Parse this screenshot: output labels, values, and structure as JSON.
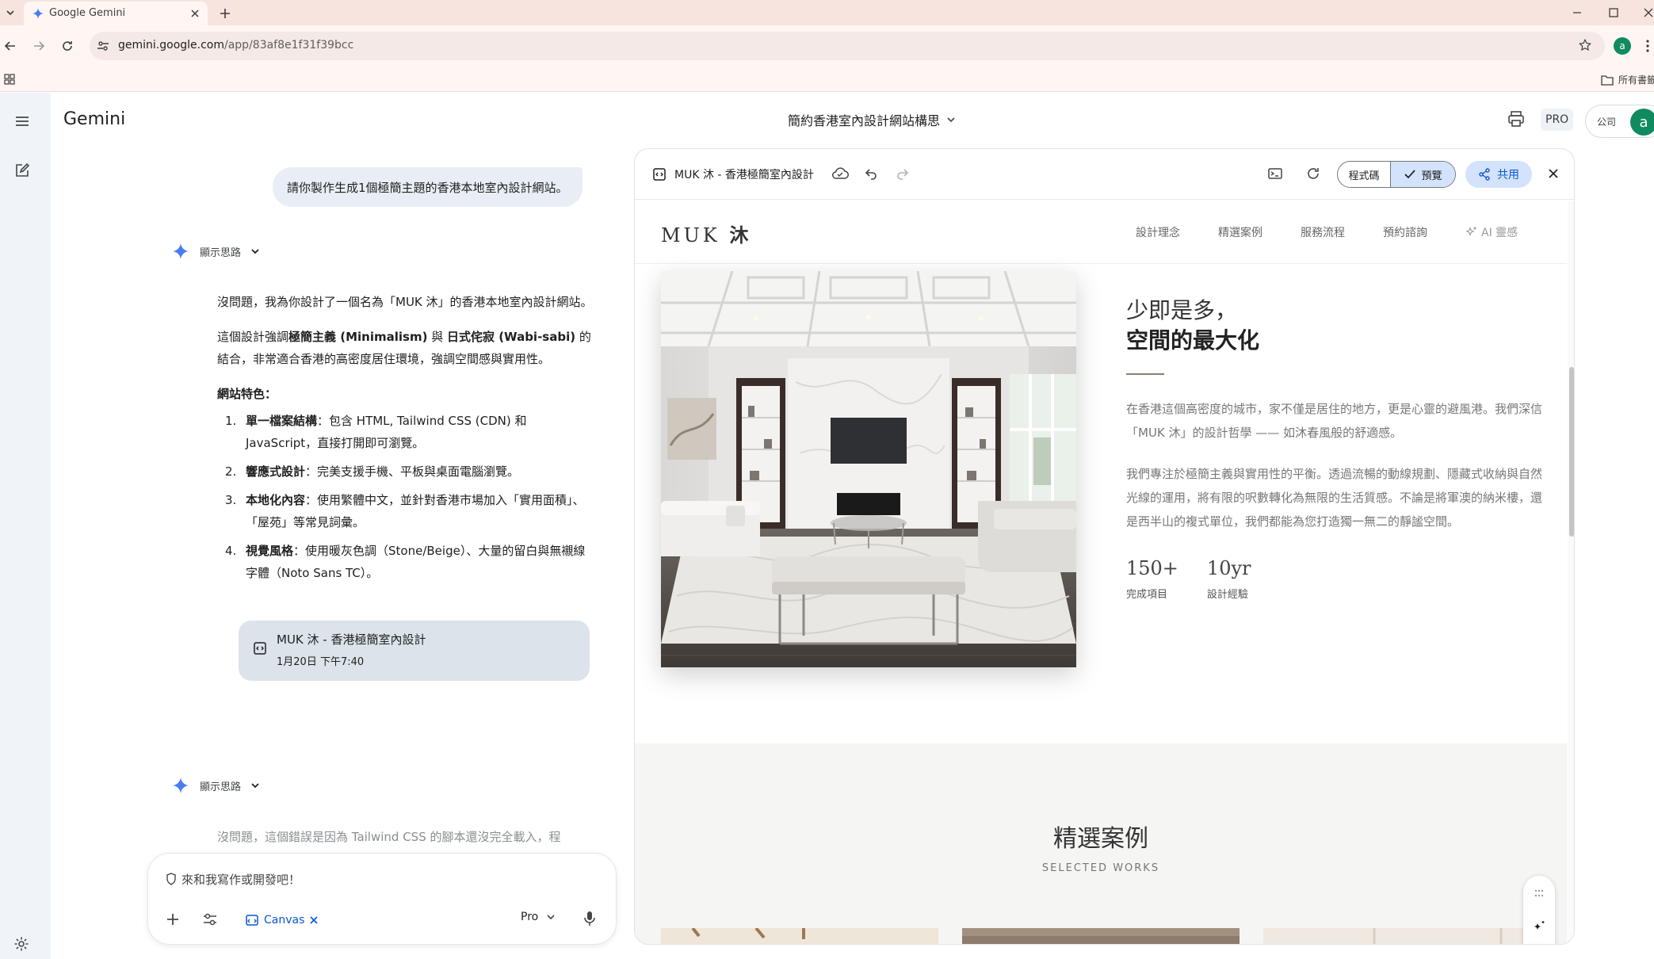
{
  "browser": {
    "tab_title": "Google Gemini",
    "url_host": "gemini.google.com",
    "url_path": "/app/83af8e1f31f39bcc",
    "profile_initial": "a",
    "all_bookmarks": "所有書籤"
  },
  "app": {
    "brand": "Gemini",
    "conversation_title": "簡約香港室內設計網站構思",
    "pro_badge": "PRO",
    "org_label": "公司",
    "avatar_initial": "a"
  },
  "chat": {
    "user_message": "請你製作生成1個極簡主題的香港本地室內設計網站。",
    "thoughts_label": "顯示思路",
    "response_intro": "沒問題，我為你設計了一個名為「MUK 沐」的香港本地室內設計網站。",
    "response_p2_before": "這個設計強調",
    "response_p2_bold1": "極簡主義 (Minimalism)",
    "response_p2_mid": " 與 ",
    "response_p2_bold2": "日式侘寂 (Wabi-sabi)",
    "response_p2_after": " 的結合，非常適合香港的高密度居住環境，強調空間感與實用性。",
    "features_heading": "網站特色：",
    "features": [
      {
        "num": "1.",
        "title": "單一檔案結構",
        "text": "：包含 HTML, Tailwind CSS (CDN) 和 JavaScript，直接打開即可瀏覽。"
      },
      {
        "num": "2.",
        "title": "響應式設計",
        "text": "：完美支援手機、平板與桌面電腦瀏覽。"
      },
      {
        "num": "3.",
        "title": "本地化內容",
        "text": "：使用繁體中文，並針對香港市場加入「實用面積」、「屋苑」等常見詞彙。"
      },
      {
        "num": "4.",
        "title": "視覺風格",
        "text": "：使用暖灰色調（Stone/Beige）、大量的留白與無襯線字體（Noto Sans TC）。"
      }
    ],
    "artifact_title": "MUK 沐 - 香港極簡室內設計",
    "artifact_time": "1月20日 下午7:40",
    "response2_partial": "沒問題，這個錯誤是因為 Tailwind CSS 的腳本還沒完全載入，程"
  },
  "composer": {
    "placeholder": "來和我寫作或開發吧！",
    "canvas_chip": "Canvas",
    "model": "Pro"
  },
  "canvas": {
    "doc_title": "MUK 沐 - 香港極簡室內設計",
    "code_tab": "程式碼",
    "preview_tab": "預覽",
    "share": "共用"
  },
  "site": {
    "logo_latin": "MUK ",
    "logo_cjk": "沐",
    "nav": [
      "設計理念",
      "精選案例",
      "服務流程",
      "預約諮詢"
    ],
    "nav_ai": "AI 靈感",
    "hero_line1": "少即是多，",
    "hero_line2": "空間的最大化",
    "hero_p1": "在香港這個高密度的城市，家不僅是居住的地方，更是心靈的避風港。我們深信「MUK 沐」的設計哲學 —— 如沐春風般的舒適感。",
    "hero_p2": "我們專注於極簡主義與實用性的平衡。透過流暢的動線規劃、隱藏式收納與自然光線的運用，將有限的呎數轉化為無限的生活質感。不論是將軍澳的納米樓，還是西半山的複式單位，我們都能為您打造獨一無二的靜謐空間。",
    "stats": [
      {
        "num": "150+",
        "label": "完成項目"
      },
      {
        "num": "10yr",
        "label": "設計經驗"
      }
    ],
    "works_title": "精選案例",
    "works_subtitle": "SELECTED WORKS"
  },
  "colors": {
    "tab_strip": "#f7e4de",
    "toolbar": "#fff6f3",
    "rail": "#f0f4f9",
    "accent": "#0b57d0",
    "preview_selected": "#d3e3fd",
    "avatar": "#0f8b5f"
  },
  "icons": [
    "menu-icon",
    "new-chat-icon",
    "settings-icon",
    "gemini-spark-icon",
    "chevron-down-icon",
    "code-doc-icon",
    "cloud-icon",
    "undo-icon",
    "redo-icon",
    "console-icon",
    "refresh-icon",
    "check-icon",
    "share-icon",
    "close-icon",
    "plus-icon",
    "tools-icon",
    "canvas-icon",
    "mic-icon",
    "shield-icon",
    "print-icon",
    "star-icon",
    "site-info-icon",
    "apps-icon",
    "folder-icon",
    "sparkle-icon"
  ]
}
